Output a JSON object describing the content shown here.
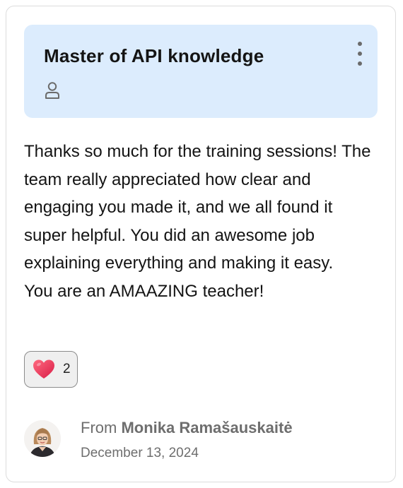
{
  "card": {
    "title": "Master of API knowledge",
    "icons": {
      "menu": "more-vertical-icon",
      "recipient": "person-icon"
    },
    "message": "Thanks so much for the training sessions! The team really appreciated how clear and engaging you made it, and we all found it super helpful. You did an awesome job explaining everything and making it easy.\nYou are an AMAAZING teacher!",
    "reaction": {
      "emoji": "heart-icon",
      "count": "2"
    },
    "author": {
      "from_label": "From",
      "name": "Monika Ramašauskaitė",
      "date": "December 13, 2024"
    }
  },
  "colors": {
    "header_bg": "#dcecfd",
    "text": "#141414",
    "muted": "#6e6e6e",
    "heart": "#e8304f"
  }
}
